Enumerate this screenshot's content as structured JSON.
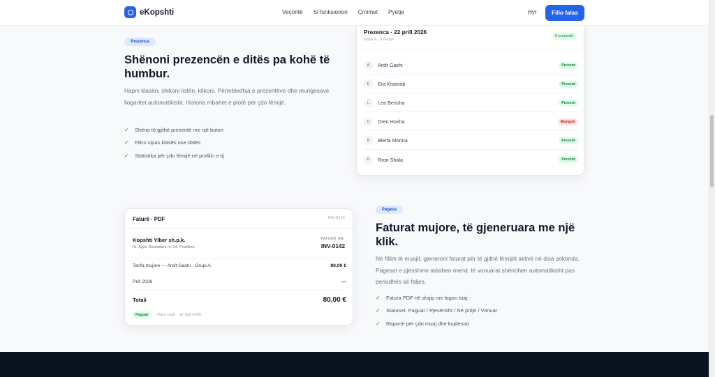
{
  "header": {
    "brand": "eKopshti",
    "nav": [
      "Veçoritë",
      "Si funksionon",
      "Çmimet",
      "Pyetje"
    ],
    "login": "Hyr",
    "cta": "Fillo falas"
  },
  "attendance_section": {
    "badge": "Prezenca",
    "heading": "Shënoni prezencën e ditës pa kohë të humbur.",
    "lead": "Hapni klasën, shikoni listën, klikoni. Përmbledhja e prezentëve dhe mungesave llogaritet automatikisht. Historia mbahet e plotë për çdo fëmijë.",
    "features": [
      "Shëno të gjithë prezentë me një buton",
      "Filtro sipas klasës ose datës",
      "Statistika për çdo fëmijë në profilin e tij"
    ],
    "card": {
      "title": "Prezenca · 22 prill 2026",
      "subtitle": "Grupi A · 6 fëmijë",
      "count_badge": "5 prezentë",
      "rows": [
        {
          "initial": "A",
          "name": "Ardit Gashi",
          "status": "Prezent",
          "kind": "present"
        },
        {
          "initial": "E",
          "name": "Era Krasniqi",
          "status": "Prezent",
          "kind": "present"
        },
        {
          "initial": "L",
          "name": "Lea Berisha",
          "status": "Prezent",
          "kind": "present"
        },
        {
          "initial": "D",
          "name": "Dren Hoxha",
          "status": "Mungon",
          "kind": "absent"
        },
        {
          "initial": "B",
          "name": "Blerta Morina",
          "status": "Prezent",
          "kind": "present"
        },
        {
          "initial": "R",
          "name": "Rron Shala",
          "status": "Prezent",
          "kind": "present"
        }
      ]
    }
  },
  "invoice_section": {
    "badge": "Pagesa",
    "heading": "Faturat mujore, të gjeneruara me një klik.",
    "lead": "Në fillim të muajit, gjeneroni faturat për të gjithë fëmijët aktivë në disa sekonda. Pagesat e pjesshme mbahen mend, të vonuarat shënohen automatikisht pas periudhës së faljes.",
    "features": [
      "Fatura PDF në shqip me logon tuaj",
      "Statuset: Paguar / Pjesërisht / Në pritje / Vonuar",
      "Raporte për çdo muaj dhe kujdestar"
    ],
    "card": {
      "title": "Faturë · PDF",
      "number_small": "INV-0142",
      "company": "Kopshti Ylber sh.p.k.",
      "address": "Rr. Agim Ramadani nr. 14, Prishtinë",
      "number_label": "FATURË NR.",
      "number": "INV-0142",
      "line1_label": "Tarifa mujore — Ardit Gashi · Grupi A",
      "line1_amount": "80,00 €",
      "line2_label": "Prill 2026",
      "line2_amount": "—",
      "total_label": "Totali",
      "total_amount": "80,00 €",
      "status": "Paguar",
      "payment_note": "· Para cash · 12 prill 2026"
    }
  },
  "colors": {
    "accent": "#2563eb",
    "present": "#15803d",
    "absent": "#b91c1c",
    "footer": "#0b1220"
  }
}
